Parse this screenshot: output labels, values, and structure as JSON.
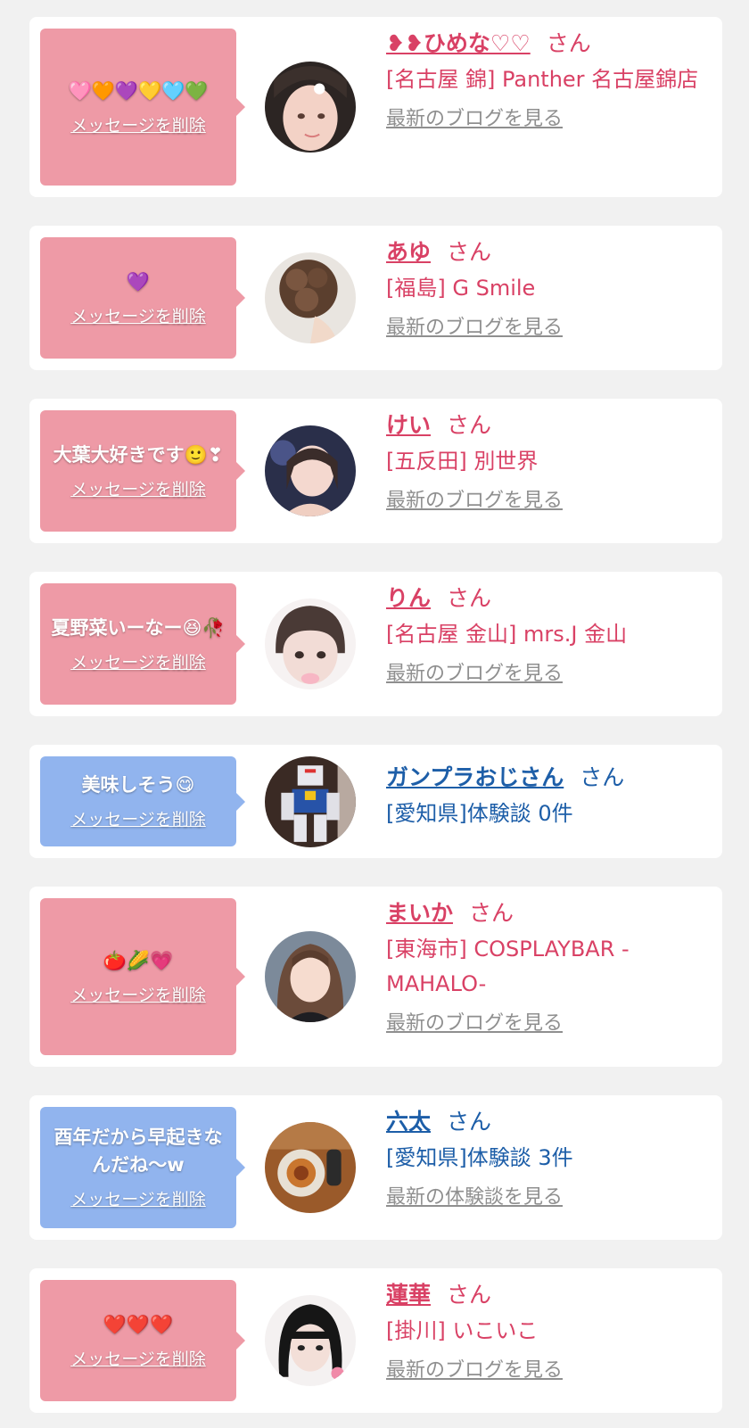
{
  "delete_label": "メッセージを削除",
  "cards": [
    {
      "message": "🩷🧡💜💛🩵💚",
      "name": "❥❥ひめな♡♡",
      "honorific": "さん",
      "shop": "[名古屋 錦] Panther 名古屋錦店",
      "link": "最新のブログを見る"
    },
    {
      "message": "💜",
      "name": "あゆ",
      "honorific": "さん",
      "shop": "[福島] G Smile",
      "link": "最新のブログを見る"
    },
    {
      "message": "大葉大好きです🙂❣",
      "name": "けい",
      "honorific": "さん",
      "shop": "[五反田] 別世界",
      "link": "最新のブログを見る"
    },
    {
      "message": "夏野菜いーなー😆🥀",
      "name": "りん",
      "honorific": "さん",
      "shop": "[名古屋 金山] mrs.J 金山",
      "link": "最新のブログを見る"
    },
    {
      "message": "美味しそう😋",
      "name": "ガンプラおじさん",
      "honorific": "さん",
      "shop": "[愛知県]体験談 0件",
      "link": ""
    },
    {
      "message": "🍅🌽💗",
      "name": "まいか",
      "honorific": "さん",
      "shop": "[東海市] COSPLAYBAR -MAHALO-",
      "link": "最新のブログを見る"
    },
    {
      "message": "酉年だから早起きなんだね〜w",
      "name": "六太",
      "honorific": "さん",
      "shop": "[愛知県]体験談 3件",
      "link": "最新の体験談を見る"
    },
    {
      "message": "❤️❤️❤️",
      "name": "蓮華",
      "honorific": "さん",
      "shop": "[掛川] いこいこ",
      "link": "最新のブログを見る"
    }
  ],
  "colors": {
    "pink_bubble": "#ee9aa6",
    "blue_bubble": "#91b4ee",
    "pink_text": "#d94165",
    "blue_text": "#1d5ea8",
    "link_gray": "#8f8f8f",
    "background": "#f1f1f1"
  }
}
